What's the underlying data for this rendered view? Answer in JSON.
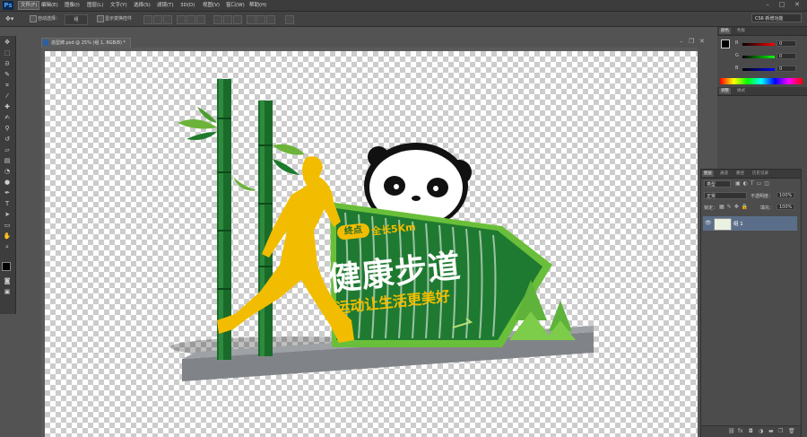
{
  "app": {
    "logo": "Ps",
    "workspace": "CS6 新增功能"
  },
  "menu": {
    "items": [
      "文件(F)",
      "编辑(E)",
      "图像(I)",
      "图层(L)",
      "文字(Y)",
      "选择(S)",
      "滤镜(T)",
      "3D(D)",
      "视图(V)",
      "窗口(W)",
      "帮助(H)"
    ],
    "active_index": 0
  },
  "window_controls": {
    "minimize": "–",
    "maximize": "□",
    "close": "✕"
  },
  "options": {
    "auto_select_label": "自动选择：",
    "auto_select_value": "组",
    "show_transform_label": "显示变换控件"
  },
  "document": {
    "tab_title": "造型牌.psd @ 25% (组 1, RGB/8) *"
  },
  "sign": {
    "title": "健康步道",
    "badge": "终点",
    "distance": "全长5Km",
    "slogan": "运动让生活更美好"
  },
  "color_panel": {
    "tabs": [
      "颜色",
      "色板"
    ],
    "channels": [
      {
        "label": "R",
        "value": "0"
      },
      {
        "label": "G",
        "value": "0"
      },
      {
        "label": "B",
        "value": "0"
      }
    ]
  },
  "adjust_panel": {
    "tabs": [
      "调整",
      "样式"
    ]
  },
  "layers_panel": {
    "tabs": [
      "图层",
      "通道",
      "路径",
      "历史记录"
    ],
    "filter": "类型",
    "blend_mode": "正常",
    "opacity_label": "不透明度：",
    "opacity": "100%",
    "lock_label": "锁定：",
    "fill_label": "填充：",
    "fill": "100%",
    "layer_name": "组 1",
    "footer_icons": [
      "link-icon",
      "fx-icon",
      "mask-icon",
      "adjustment-icon",
      "folder-icon",
      "new-layer-icon",
      "trash-icon"
    ]
  },
  "colors": {
    "accent_green": "#7bc143",
    "dark_green": "#1e6b2a",
    "runner_yellow": "#f2bd00",
    "selection": "#5b6e89"
  }
}
